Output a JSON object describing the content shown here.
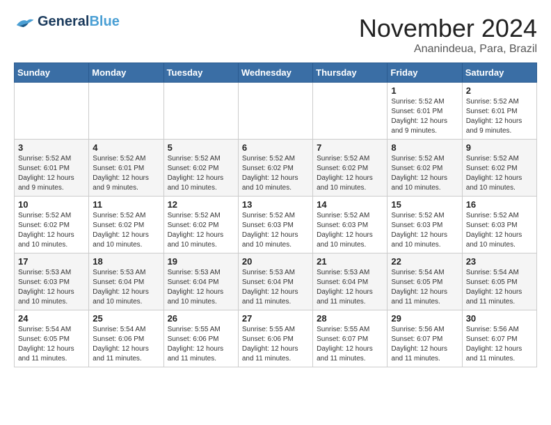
{
  "header": {
    "logo_general": "General",
    "logo_blue": "Blue",
    "month_title": "November 2024",
    "location": "Ananindeua, Para, Brazil"
  },
  "weekdays": [
    "Sunday",
    "Monday",
    "Tuesday",
    "Wednesday",
    "Thursday",
    "Friday",
    "Saturday"
  ],
  "weeks": [
    [
      {
        "day": "",
        "info": ""
      },
      {
        "day": "",
        "info": ""
      },
      {
        "day": "",
        "info": ""
      },
      {
        "day": "",
        "info": ""
      },
      {
        "day": "",
        "info": ""
      },
      {
        "day": "1",
        "info": "Sunrise: 5:52 AM\nSunset: 6:01 PM\nDaylight: 12 hours\nand 9 minutes."
      },
      {
        "day": "2",
        "info": "Sunrise: 5:52 AM\nSunset: 6:01 PM\nDaylight: 12 hours\nand 9 minutes."
      }
    ],
    [
      {
        "day": "3",
        "info": "Sunrise: 5:52 AM\nSunset: 6:01 PM\nDaylight: 12 hours\nand 9 minutes."
      },
      {
        "day": "4",
        "info": "Sunrise: 5:52 AM\nSunset: 6:01 PM\nDaylight: 12 hours\nand 9 minutes."
      },
      {
        "day": "5",
        "info": "Sunrise: 5:52 AM\nSunset: 6:02 PM\nDaylight: 12 hours\nand 10 minutes."
      },
      {
        "day": "6",
        "info": "Sunrise: 5:52 AM\nSunset: 6:02 PM\nDaylight: 12 hours\nand 10 minutes."
      },
      {
        "day": "7",
        "info": "Sunrise: 5:52 AM\nSunset: 6:02 PM\nDaylight: 12 hours\nand 10 minutes."
      },
      {
        "day": "8",
        "info": "Sunrise: 5:52 AM\nSunset: 6:02 PM\nDaylight: 12 hours\nand 10 minutes."
      },
      {
        "day": "9",
        "info": "Sunrise: 5:52 AM\nSunset: 6:02 PM\nDaylight: 12 hours\nand 10 minutes."
      }
    ],
    [
      {
        "day": "10",
        "info": "Sunrise: 5:52 AM\nSunset: 6:02 PM\nDaylight: 12 hours\nand 10 minutes."
      },
      {
        "day": "11",
        "info": "Sunrise: 5:52 AM\nSunset: 6:02 PM\nDaylight: 12 hours\nand 10 minutes."
      },
      {
        "day": "12",
        "info": "Sunrise: 5:52 AM\nSunset: 6:02 PM\nDaylight: 12 hours\nand 10 minutes."
      },
      {
        "day": "13",
        "info": "Sunrise: 5:52 AM\nSunset: 6:03 PM\nDaylight: 12 hours\nand 10 minutes."
      },
      {
        "day": "14",
        "info": "Sunrise: 5:52 AM\nSunset: 6:03 PM\nDaylight: 12 hours\nand 10 minutes."
      },
      {
        "day": "15",
        "info": "Sunrise: 5:52 AM\nSunset: 6:03 PM\nDaylight: 12 hours\nand 10 minutes."
      },
      {
        "day": "16",
        "info": "Sunrise: 5:52 AM\nSunset: 6:03 PM\nDaylight: 12 hours\nand 10 minutes."
      }
    ],
    [
      {
        "day": "17",
        "info": "Sunrise: 5:53 AM\nSunset: 6:03 PM\nDaylight: 12 hours\nand 10 minutes."
      },
      {
        "day": "18",
        "info": "Sunrise: 5:53 AM\nSunset: 6:04 PM\nDaylight: 12 hours\nand 10 minutes."
      },
      {
        "day": "19",
        "info": "Sunrise: 5:53 AM\nSunset: 6:04 PM\nDaylight: 12 hours\nand 10 minutes."
      },
      {
        "day": "20",
        "info": "Sunrise: 5:53 AM\nSunset: 6:04 PM\nDaylight: 12 hours\nand 11 minutes."
      },
      {
        "day": "21",
        "info": "Sunrise: 5:53 AM\nSunset: 6:04 PM\nDaylight: 12 hours\nand 11 minutes."
      },
      {
        "day": "22",
        "info": "Sunrise: 5:54 AM\nSunset: 6:05 PM\nDaylight: 12 hours\nand 11 minutes."
      },
      {
        "day": "23",
        "info": "Sunrise: 5:54 AM\nSunset: 6:05 PM\nDaylight: 12 hours\nand 11 minutes."
      }
    ],
    [
      {
        "day": "24",
        "info": "Sunrise: 5:54 AM\nSunset: 6:05 PM\nDaylight: 12 hours\nand 11 minutes."
      },
      {
        "day": "25",
        "info": "Sunrise: 5:54 AM\nSunset: 6:06 PM\nDaylight: 12 hours\nand 11 minutes."
      },
      {
        "day": "26",
        "info": "Sunrise: 5:55 AM\nSunset: 6:06 PM\nDaylight: 12 hours\nand 11 minutes."
      },
      {
        "day": "27",
        "info": "Sunrise: 5:55 AM\nSunset: 6:06 PM\nDaylight: 12 hours\nand 11 minutes."
      },
      {
        "day": "28",
        "info": "Sunrise: 5:55 AM\nSunset: 6:07 PM\nDaylight: 12 hours\nand 11 minutes."
      },
      {
        "day": "29",
        "info": "Sunrise: 5:56 AM\nSunset: 6:07 PM\nDaylight: 12 hours\nand 11 minutes."
      },
      {
        "day": "30",
        "info": "Sunrise: 5:56 AM\nSunset: 6:07 PM\nDaylight: 12 hours\nand 11 minutes."
      }
    ]
  ]
}
